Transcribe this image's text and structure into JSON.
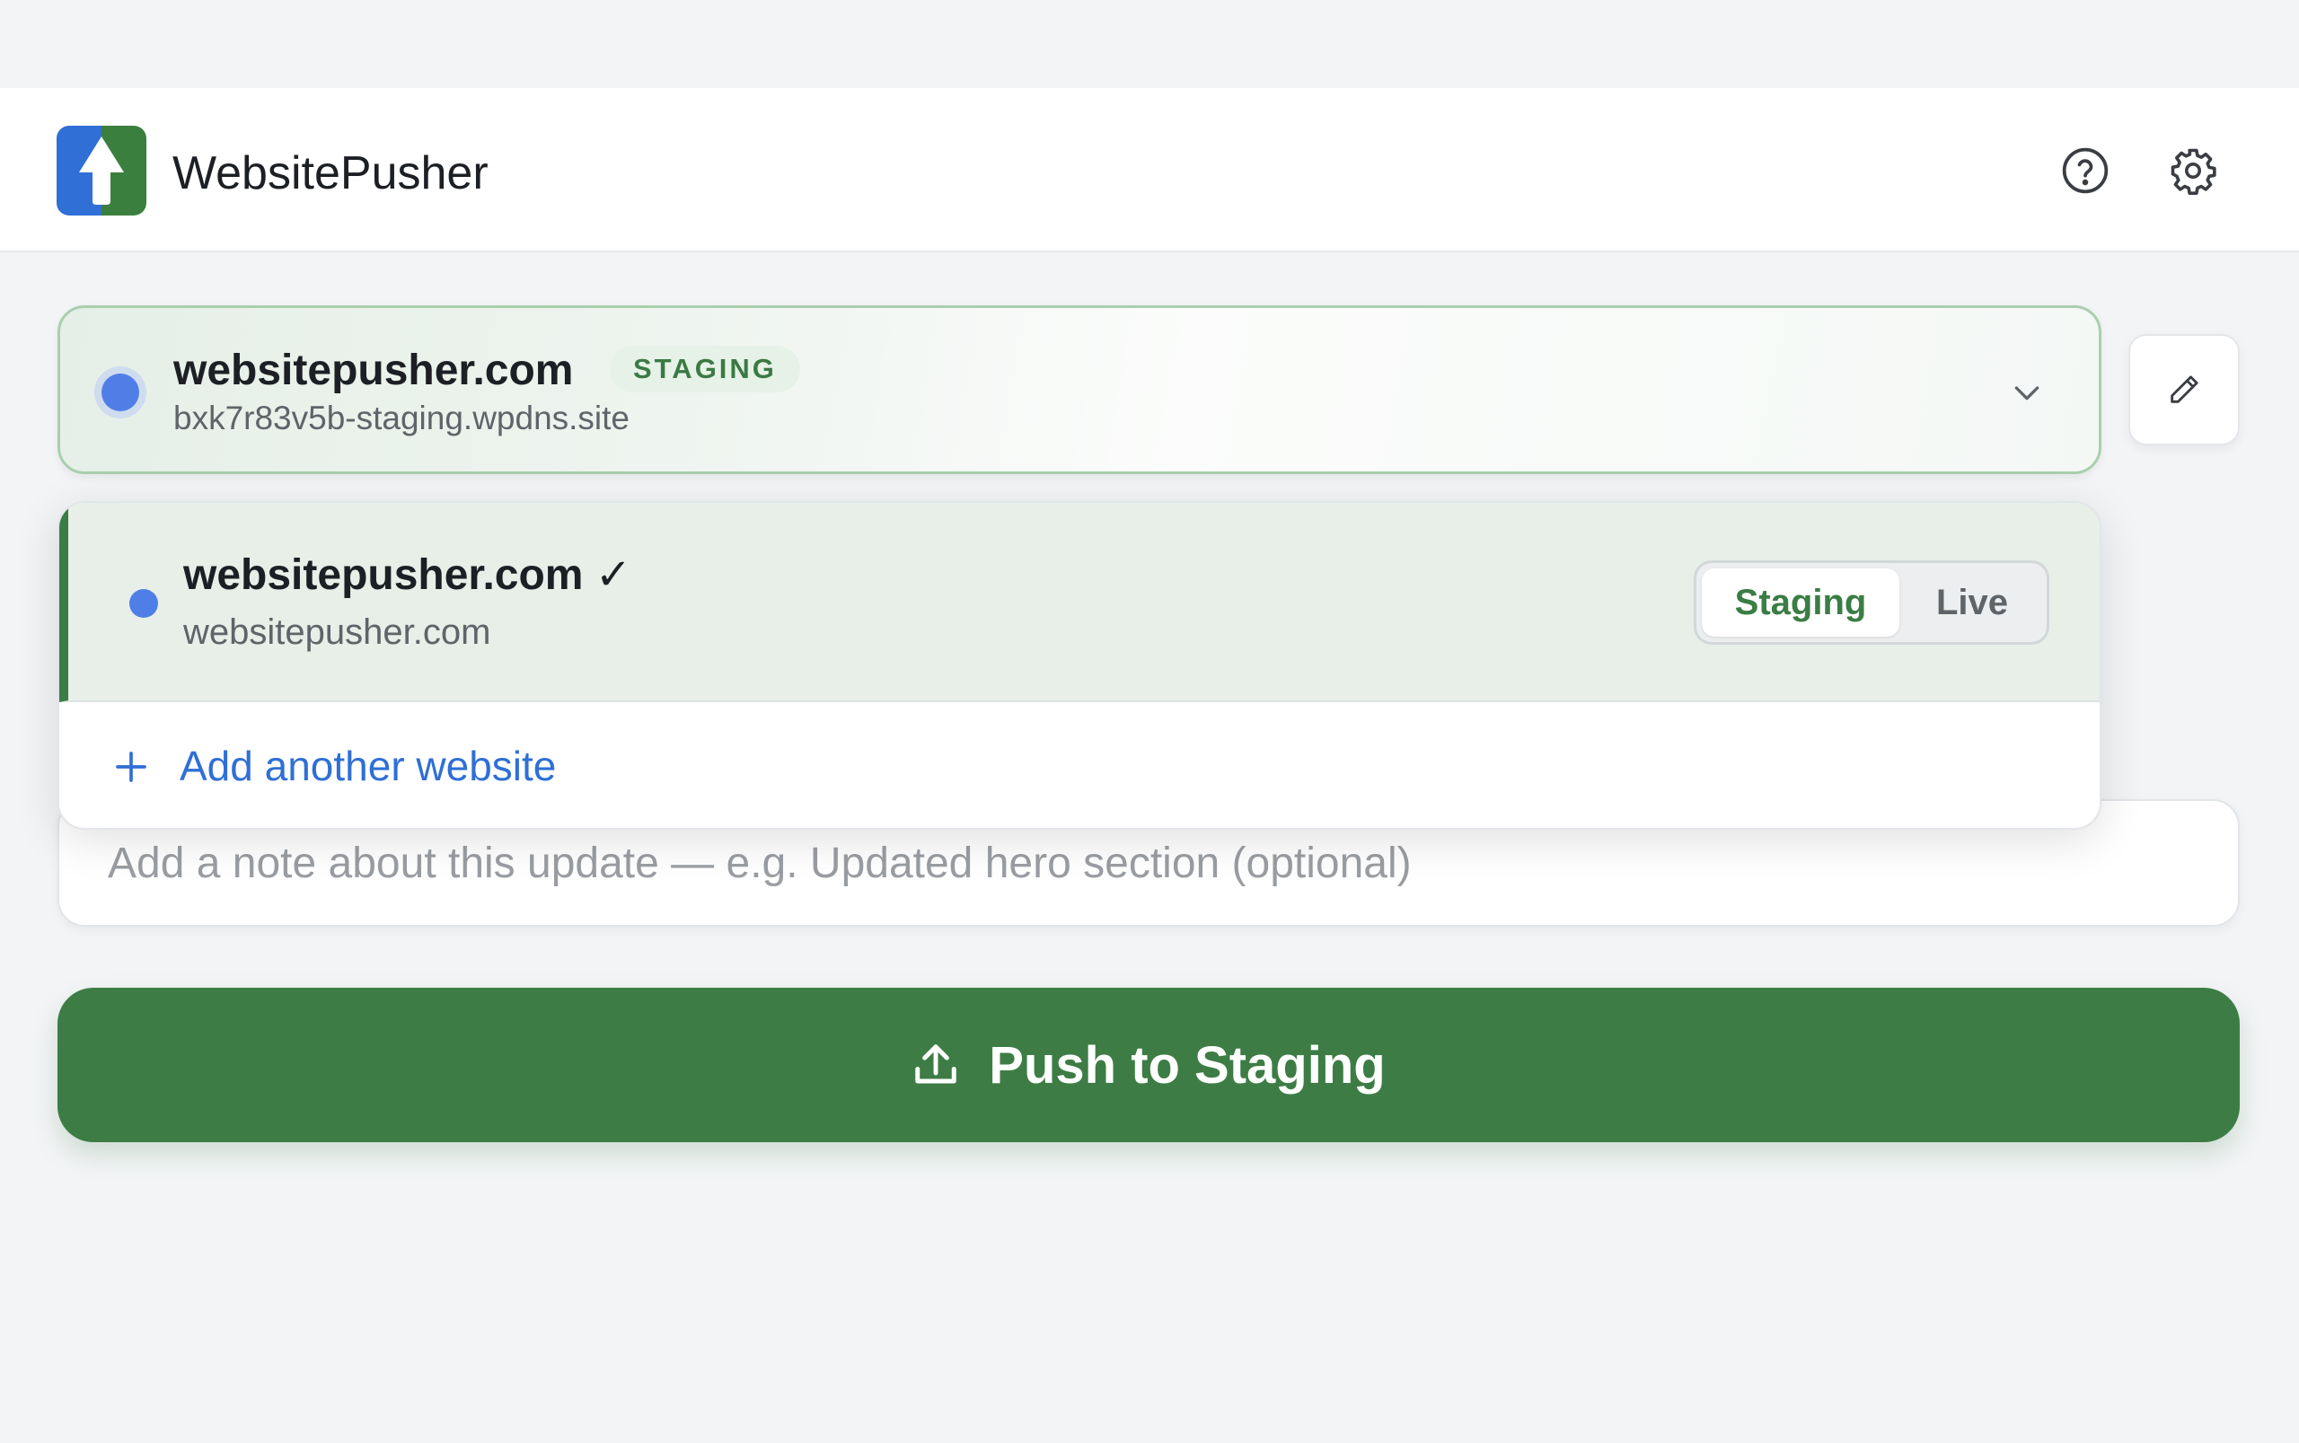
{
  "app": {
    "title": "WebsitePusher"
  },
  "header": {
    "help_icon": "question-circle-icon",
    "settings_icon": "gear-icon"
  },
  "selected_site": {
    "name": "websitepusher.com",
    "badge": "STAGING",
    "url": "bxk7r83v5b-staging.wpdns.site"
  },
  "dropdown": {
    "sites": [
      {
        "name": "websitepusher.com ✓",
        "url": "websitepusher.com",
        "environments": [
          "Staging",
          "Live"
        ],
        "active_environment": "Staging"
      }
    ],
    "add_label": "Add another website"
  },
  "note": {
    "placeholder": "Add a note about this update — e.g. Updated hero section (optional)"
  },
  "push_button": {
    "label": "Push to Staging"
  },
  "colors": {
    "brand_green": "#3d7d45",
    "brand_blue": "#2f6fd6",
    "site_dot": "#4f7fe6"
  }
}
